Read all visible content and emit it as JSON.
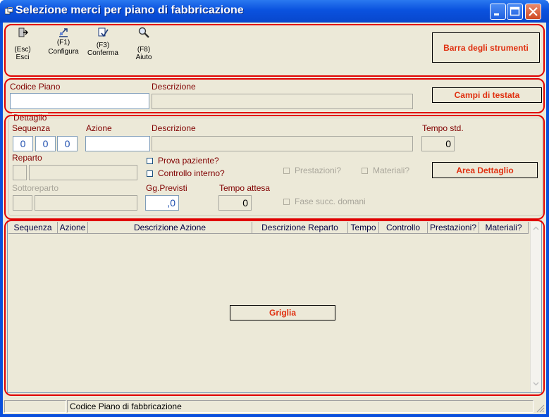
{
  "window": {
    "title": "Selezione merci per piano di fabbricazione"
  },
  "toolbar": [
    {
      "key": "(Esc)",
      "label": "Esci",
      "icon": "exit-door-icon"
    },
    {
      "key": "(F1)",
      "label": "Configura",
      "icon": "configure-icon"
    },
    {
      "key": "(F3)",
      "label": "Conferma",
      "icon": "confirm-icon"
    },
    {
      "key": "(F8)",
      "label": "Aiuto",
      "icon": "magnifier-help-icon"
    }
  ],
  "callouts": {
    "toolbar": "Barra degli strumenti",
    "header": "Campi di testata",
    "detail": "Area Dettaglio",
    "grid": "Griglia"
  },
  "header": {
    "codice_piano_label": "Codice Piano",
    "codice_piano_value": "",
    "descrizione_label": "Descrizione",
    "descrizione_value": ""
  },
  "detail": {
    "legend": "Dettaglio",
    "sequenza_label": "Sequenza",
    "sequenza_values": [
      "0",
      "0",
      "0"
    ],
    "azione_label": "Azione",
    "azione_value": "",
    "descrizione_label": "Descrizione",
    "descrizione_value": "",
    "tempo_std_label": "Tempo std.",
    "tempo_std_value": "0",
    "reparto_label": "Reparto",
    "prova_paziente_label": "Prova paziente?",
    "controllo_interno_label": "Controllo interno?",
    "prestazioni_label": "Prestazioni?",
    "materiali_label": "Materiali?",
    "sottoreparto_label": "Sottoreparto",
    "gg_previsti_label": "Gg.Previsti",
    "gg_previsti_value": ",0",
    "tempo_attesa_label": "Tempo attesa",
    "tempo_attesa_value": "0",
    "fase_succ_label": "Fase succ. domani"
  },
  "grid": {
    "columns": [
      "Sequenza",
      "Azione",
      "Descrizione Azione",
      "Descrizione Reparto",
      "Tempo",
      "Controllo",
      "Prestazioni?",
      "Materiali?"
    ],
    "rows": []
  },
  "statusbar": {
    "panel1": "",
    "panel2": "Codice Piano di fabbricazione"
  },
  "colors": {
    "titlebar": "#0a52de",
    "annotation_box": "#e00000",
    "callout_text": "#e03010",
    "label_text": "#800000",
    "value_text": "#1f4faf"
  }
}
